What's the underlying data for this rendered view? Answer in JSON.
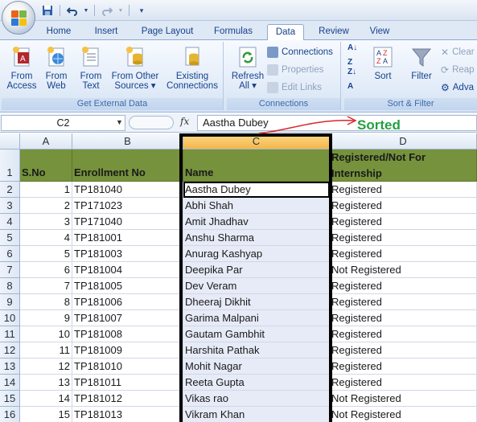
{
  "tabs": [
    "Home",
    "Insert",
    "Page Layout",
    "Formulas",
    "Data",
    "Review",
    "View"
  ],
  "active_tab": "Data",
  "ribbon": {
    "get_external_data": {
      "label": "Get External Data",
      "buttons": [
        {
          "line1": "From",
          "line2": "Access",
          "icon": "access-icon"
        },
        {
          "line1": "From",
          "line2": "Web",
          "icon": "web-icon"
        },
        {
          "line1": "From",
          "line2": "Text",
          "icon": "text-file-icon"
        },
        {
          "line1": "From Other",
          "line2": "Sources ▾",
          "icon": "other-sources-icon"
        },
        {
          "line1": "Existing",
          "line2": "Connections",
          "icon": "existing-connections-icon"
        }
      ]
    },
    "connections": {
      "label": "Connections",
      "refresh_line1": "Refresh",
      "refresh_line2": "All ▾",
      "connections": "Connections",
      "properties": "Properties",
      "edit_links": "Edit Links"
    },
    "sort_filter": {
      "label": "Sort & Filter",
      "sort": "Sort",
      "filter": "Filter",
      "clear": "Clear",
      "reapply": "Reap",
      "advanced": "Adva"
    }
  },
  "formula_bar": {
    "name_box": "C2",
    "fx": "fx",
    "value": "Aastha Dubey"
  },
  "annotation": "Sorted",
  "columns": [
    "A",
    "B",
    "C",
    "D"
  ],
  "header_row": {
    "row_num": "1",
    "a": "S.No",
    "b": "Enrollment No",
    "c": "Name",
    "d_line1": "Registered/Not For",
    "d_line2": "Internship"
  },
  "rows": [
    {
      "n": "2",
      "a": "1",
      "b": "TP181040",
      "c": "Aastha Dubey",
      "d": "Registered"
    },
    {
      "n": "3",
      "a": "2",
      "b": "TP171023",
      "c": "Abhi Shah",
      "d": "Registered"
    },
    {
      "n": "4",
      "a": "3",
      "b": "TP171040",
      "c": "Amit Jhadhav",
      "d": "Registered"
    },
    {
      "n": "5",
      "a": "4",
      "b": "TP181001",
      "c": "Anshu Sharma",
      "d": "Registered"
    },
    {
      "n": "6",
      "a": "5",
      "b": "TP181003",
      "c": "Anurag Kashyap",
      "d": "Registered"
    },
    {
      "n": "7",
      "a": "6",
      "b": "TP181004",
      "c": "Deepika Par",
      "d": "Not Registered"
    },
    {
      "n": "8",
      "a": "7",
      "b": "TP181005",
      "c": "Dev Veram",
      "d": "Registered"
    },
    {
      "n": "9",
      "a": "8",
      "b": "TP181006",
      "c": "Dheeraj Dikhit",
      "d": "Registered"
    },
    {
      "n": "10",
      "a": "9",
      "b": "TP181007",
      "c": "Garima Malpani",
      "d": "Registered"
    },
    {
      "n": "11",
      "a": "10",
      "b": "TP181008",
      "c": "Gautam Gambhit",
      "d": "Registered"
    },
    {
      "n": "12",
      "a": "11",
      "b": "TP181009",
      "c": "Harshita Pathak",
      "d": "Registered"
    },
    {
      "n": "13",
      "a": "12",
      "b": "TP181010",
      "c": "Mohit Nagar",
      "d": "Registered"
    },
    {
      "n": "14",
      "a": "13",
      "b": "TP181011",
      "c": "Reeta Gupta",
      "d": "Registered"
    },
    {
      "n": "15",
      "a": "14",
      "b": "TP181012",
      "c": "Vikas rao",
      "d": "Not Registered"
    },
    {
      "n": "16",
      "a": "15",
      "b": "TP181013",
      "c": "Vikram Khan",
      "d": "Not Registered"
    }
  ],
  "colors": {
    "header_fill": "#76923c",
    "sorted_text": "#22a042",
    "arrow": "#d9272e"
  }
}
